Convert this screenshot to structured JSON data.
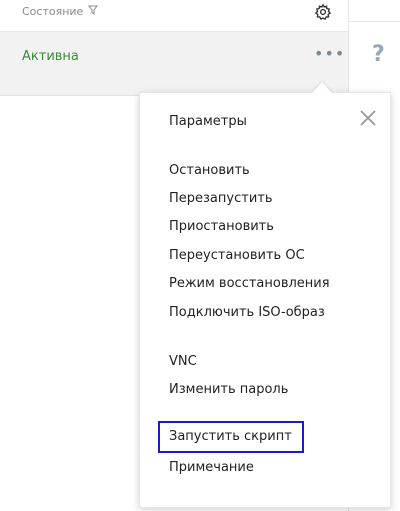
{
  "table": {
    "column_status_label": "Состояние",
    "row": {
      "status": "Активна",
      "status_color": "#3a8a3a"
    }
  },
  "menu": {
    "groups": [
      [
        "Параметры"
      ],
      [
        "Остановить",
        "Перезапустить",
        "Приостановить",
        "Переустановить ОС",
        "Режим восстановления",
        "Подключить ISO-образ"
      ],
      [
        "VNC",
        "Изменить пароль"
      ],
      [
        "Запустить скрипт",
        "Примечание"
      ]
    ],
    "highlighted_item": "Запустить скрипт",
    "highlight_color": "#1a1acb"
  },
  "icons": {
    "filter": "filter-icon",
    "settings": "gear-icon",
    "more": "more-dots-icon",
    "help": "help-icon",
    "close": "close-icon"
  },
  "help": {
    "glyph": "?"
  }
}
